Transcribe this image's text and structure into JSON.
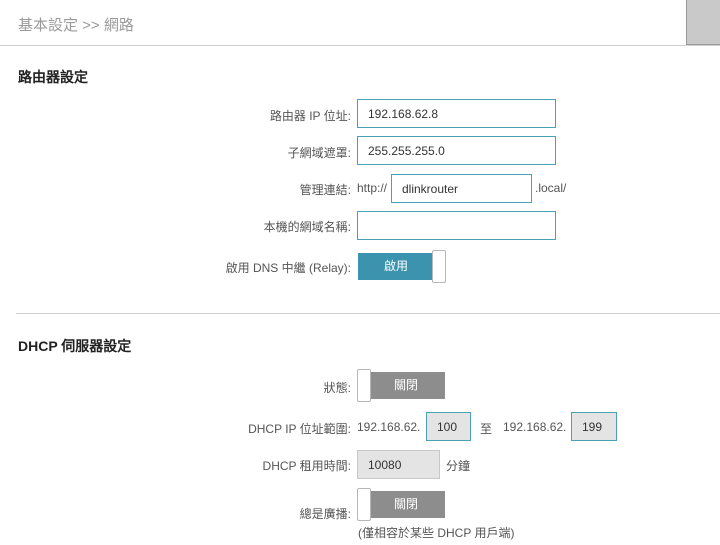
{
  "header": {
    "breadcrumb": "基本設定 >> 網路"
  },
  "router": {
    "title": "路由器設定",
    "ip_label": "路由器 IP 位址:",
    "ip_value": "192.168.62.8",
    "mask_label": "子網域遮罩:",
    "mask_value": "255.255.255.0",
    "mgmt_label": "管理連結:",
    "mgmt_prefix": "http://",
    "mgmt_value": "dlinkrouter",
    "mgmt_suffix": ".local/",
    "domain_label": "本機的網域名稱:",
    "domain_value": "",
    "dns_relay_label": "啟用 DNS 中繼 (Relay):",
    "dns_relay_state": "啟用"
  },
  "dhcp": {
    "title": "DHCP 伺服器設定",
    "status_label": "狀態:",
    "status_state": "關閉",
    "range_label": "DHCP IP 位址範圍:",
    "range_prefix1": "192.168.62.",
    "range_start": "100",
    "range_to": "至",
    "range_prefix2": "192.168.62.",
    "range_end": "199",
    "lease_label": "DHCP 租用時間:",
    "lease_value": "10080",
    "lease_unit": "分鐘",
    "broadcast_label": "總是廣播:",
    "broadcast_state": "關閉",
    "broadcast_note": "(僅相容於某些 DHCP 用戶端)"
  }
}
